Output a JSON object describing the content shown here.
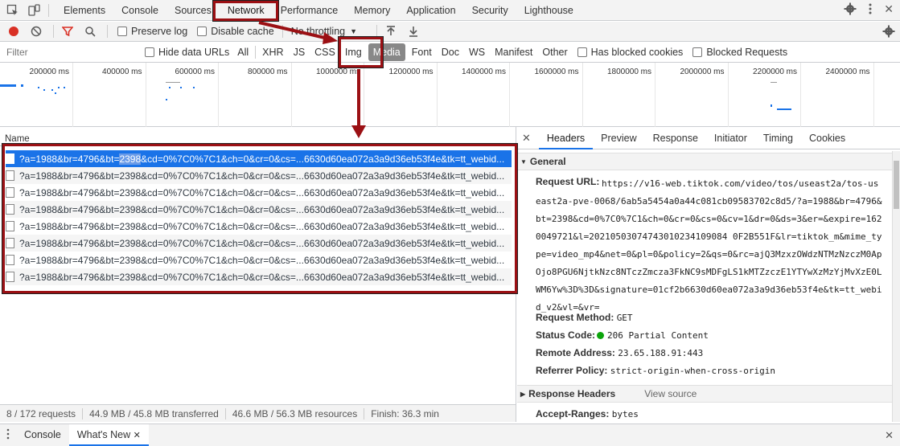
{
  "devtools": {
    "tabs": [
      "Elements",
      "Console",
      "Sources",
      "Network",
      "Performance",
      "Memory",
      "Application",
      "Security",
      "Lighthouse"
    ],
    "active_tab": "Network"
  },
  "toolbar": {
    "preserve_log": "Preserve log",
    "disable_cache": "Disable cache",
    "throttling": "No throttling"
  },
  "filterbar": {
    "placeholder": "Filter",
    "hide_data_urls": "Hide data URLs",
    "types": [
      "All",
      "XHR",
      "JS",
      "CSS",
      "Img",
      "Media",
      "Font",
      "Doc",
      "WS",
      "Manifest",
      "Other"
    ],
    "active_type": "Media",
    "has_blocked_cookies": "Has blocked cookies",
    "blocked_requests": "Blocked Requests"
  },
  "overview": {
    "labels": [
      "200000 ms",
      "400000 ms",
      "600000 ms",
      "800000 ms",
      "1000000 ms",
      "1200000 ms",
      "1400000 ms",
      "1600000 ms",
      "1800000 ms",
      "2000000 ms",
      "2200000 ms",
      "2400000 ms"
    ]
  },
  "requests": {
    "column_name": "Name",
    "rows": [
      {
        "pre": "?a=1988&br=4796&bt=",
        "hl": "2398",
        "post": "&cd=0%7C0%7C1&ch=0&cr=0&cs=...6630d60ea072a3a9d36eb53f4e&tk=tt_webid..."
      },
      {
        "pre": "?a=1988&br=4796&bt=2398&cd=0%7C0%7C1&ch=0&cr=0&cs=...6630d60ea072a3a9d36eb53f4e&tk=tt_webid...",
        "hl": "",
        "post": ""
      },
      {
        "pre": "?a=1988&br=4796&bt=2398&cd=0%7C0%7C1&ch=0&cr=0&cs=...6630d60ea072a3a9d36eb53f4e&tk=tt_webid...",
        "hl": "",
        "post": ""
      },
      {
        "pre": "?a=1988&br=4796&bt=2398&cd=0%7C0%7C1&ch=0&cr=0&cs=...6630d60ea072a3a9d36eb53f4e&tk=tt_webid...",
        "hl": "",
        "post": ""
      },
      {
        "pre": "?a=1988&br=4796&bt=2398&cd=0%7C0%7C1&ch=0&cr=0&cs=...6630d60ea072a3a9d36eb53f4e&tk=tt_webid...",
        "hl": "",
        "post": ""
      },
      {
        "pre": "?a=1988&br=4796&bt=2398&cd=0%7C0%7C1&ch=0&cr=0&cs=...6630d60ea072a3a9d36eb53f4e&tk=tt_webid...",
        "hl": "",
        "post": ""
      },
      {
        "pre": "?a=1988&br=4796&bt=2398&cd=0%7C0%7C1&ch=0&cr=0&cs=...6630d60ea072a3a9d36eb53f4e&tk=tt_webid...",
        "hl": "",
        "post": ""
      },
      {
        "pre": "?a=1988&br=4796&bt=2398&cd=0%7C0%7C1&ch=0&cr=0&cs=...6630d60ea072a3a9d36eb53f4e&tk=tt_webid...",
        "hl": "",
        "post": ""
      }
    ]
  },
  "status": {
    "requests": "8 / 172 requests",
    "transferred": "44.9 MB / 45.8 MB transferred",
    "resources": "46.6 MB / 56.3 MB resources",
    "finish": "Finish: 36.3 min"
  },
  "detail": {
    "tabs": [
      "Headers",
      "Preview",
      "Response",
      "Initiator",
      "Timing",
      "Cookies"
    ],
    "active_tab": "Headers",
    "general_title": "General",
    "request_url_label": "Request URL:",
    "request_url_value": "https://v16-web.tiktok.com/video/tos/useast2a/tos-useast2a-pve-0068/6ab5a5454a0a44c081cb09583702c8d5/?a=1988&br=4796&bt=2398&cd=0%7C0%7C1&ch=0&cr=0&cs=0&cv=1&dr=0&ds=3&er=&expire=1620049721&l=20210503074743010234109084 0F2B551F&lr=tiktok_m&mime_type=video_mp4&net=0&pl=0&policy=2&qs=0&rc=ajQ3MzxzOWdzNTMzNzczM0ApOjo8PGU6NjtkNzc8NTczZmcza3FkNC9sMDFgLS1kMTZzczE1YTYwXzMzYjMvXzE0LWM6Yw%3D%3D&signature=01cf2b6630d60ea072a3a9d36eb53f4e&tk=tt_webid_v2&vl=&vr=",
    "request_method_label": "Request Method:",
    "request_method_value": "GET",
    "status_code_label": "Status Code:",
    "status_code_value": "206 Partial Content",
    "remote_address_label": "Remote Address:",
    "remote_address_value": "23.65.188.91:443",
    "referrer_policy_label": "Referrer Policy:",
    "referrer_policy_value": "strict-origin-when-cross-origin",
    "response_headers_title": "Response Headers",
    "view_source": "View source",
    "accept_ranges_label": "Accept-Ranges:",
    "accept_ranges_value": "bytes"
  },
  "drawer": {
    "tabs": [
      "Console",
      "What's New"
    ],
    "active_tab": "What's New"
  },
  "colors": {
    "accent": "#1a73e8",
    "annotation_red": "#9b1014",
    "status_ok": "#0ca40c",
    "record": "#d93025"
  }
}
